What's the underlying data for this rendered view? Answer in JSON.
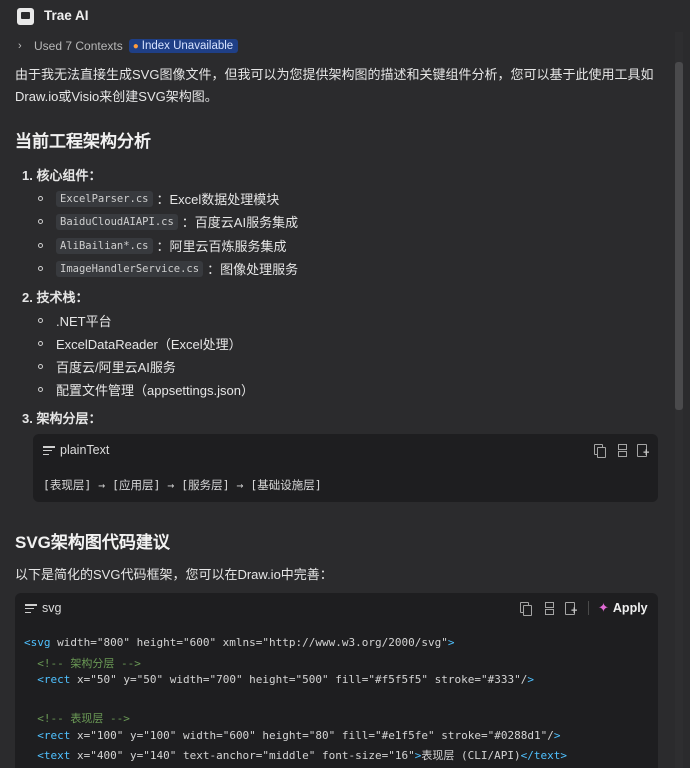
{
  "header": {
    "title": "Trae AI"
  },
  "context": {
    "label": "Used 7 Contexts",
    "badge": "Index Unavailable"
  },
  "intro": "由于我无法直接生成SVG图像文件，但我可以为您提供架构图的描述和关键组件分析，您可以基于此使用工具如Draw.io或Visio来创建SVG架构图。",
  "section1": {
    "heading": "当前工程架构分析",
    "items": [
      {
        "label": "1. 核心组件：",
        "subs": [
          {
            "code": "ExcelParser.cs",
            "text": "：Excel数据处理模块"
          },
          {
            "code": "BaiduCloudAIAPI.cs",
            "text": "：百度云AI服务集成"
          },
          {
            "code": "AliBailian*.cs",
            "text": "：阿里云百炼服务集成"
          },
          {
            "code": "ImageHandlerService.cs",
            "text": "：图像处理服务"
          }
        ]
      },
      {
        "label": "2. 技术栈：",
        "subs": [
          {
            "text": ".NET平台"
          },
          {
            "text": "ExcelDataReader（Excel处理）"
          },
          {
            "text": "百度云/阿里云AI服务"
          },
          {
            "text": "配置文件管理（appsettings.json）"
          }
        ]
      },
      {
        "label": "3. 架构分层："
      }
    ],
    "codebox": {
      "lang": "plainText",
      "content": "[表现层] → [应用层] → [服务层] → [基础设施层]"
    }
  },
  "section2": {
    "heading": "SVG架构图代码建议",
    "intro": "以下是简化的SVG代码框架，您可以在Draw.io中完善：",
    "codebox": {
      "lang": "svg",
      "apply": "Apply",
      "lines": [
        "<svg width=\"800\" height=\"600\" xmlns=\"http://www.w3.org/2000/svg\">",
        "  <!-- 架构分层 -->",
        "  <rect x=\"50\" y=\"50\" width=\"700\" height=\"500\" fill=\"#f5f5f5\" stroke=\"#333\"/>",
        "",
        "  <!-- 表现层 -->",
        "  <rect x=\"100\" y=\"100\" width=\"600\" height=\"80\" fill=\"#e1f5fe\" stroke=\"#0288d1\"/>",
        "  <text x=\"400\" y=\"140\" text-anchor=\"middle\" font-size=\"16\">表现层 (CLI/API)</text>"
      ]
    }
  },
  "icons": {
    "logo": "trae-logo-icon",
    "chevron": "chevron-right-icon",
    "badge": "warning-icon",
    "menu": "menu-icon",
    "copy": "copy-icon",
    "insert": "insert-icon",
    "newfile": "new-file-icon",
    "apply": "sparkle-icon"
  },
  "colors": {
    "background": "#2b2b2d",
    "codebg": "#1e1e20",
    "badge": "#1f3f86",
    "tag": "#4fc1ff",
    "attr": "#e5c07b",
    "string": "#98c379",
    "comment": "#6a9955"
  }
}
